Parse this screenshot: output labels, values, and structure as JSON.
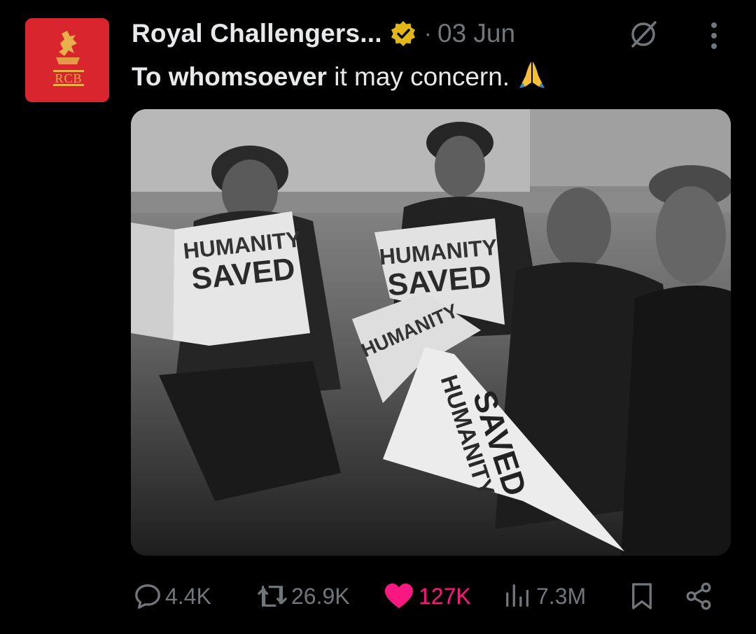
{
  "account": {
    "name": "Royal Challengers...",
    "avatar_text": "RCB",
    "verified_icon": "gold-verified-badge-icon",
    "separator": "·",
    "date": "03 Jun"
  },
  "tweet": {
    "text_bold": "To whomsoever",
    "text_rest": " it may concern.",
    "emoji": "folded-hands-emoji"
  },
  "image": {
    "newspaper_headline_1": "HUMANITY",
    "newspaper_headline_2": "SAVED"
  },
  "actions": {
    "replies": "4.4K",
    "reposts": "26.9K",
    "likes": "127K",
    "views": "7.3M",
    "like_color": "#f91880",
    "muted_color": "#71767b",
    "verified_color": "#e2b719"
  }
}
